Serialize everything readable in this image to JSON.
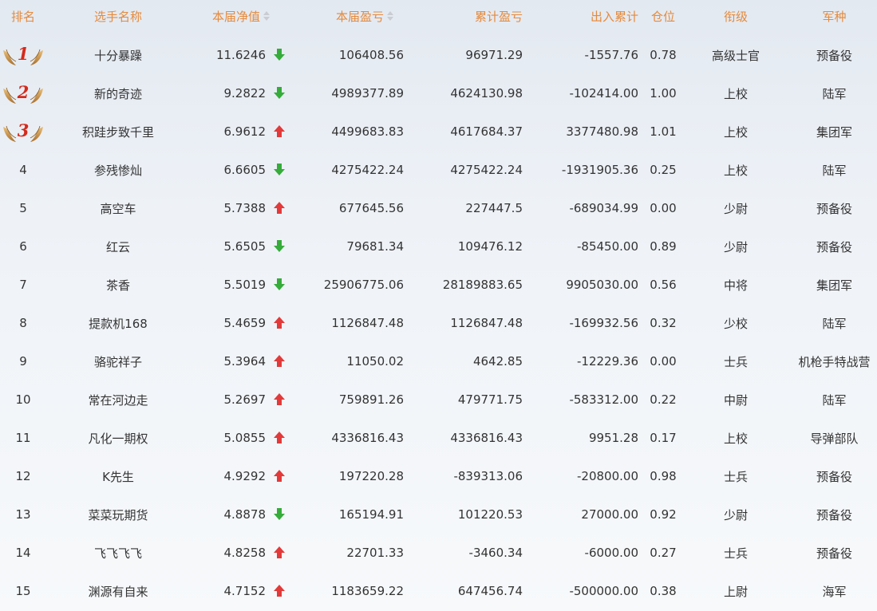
{
  "headers": {
    "rank": "排名",
    "name": "选手名称",
    "nav": "本届净值",
    "pnl": "本届盈亏",
    "total_pnl": "累计盈亏",
    "cash_flow": "出入累计",
    "position": "仓位",
    "military_rank": "衔级",
    "army": "军种"
  },
  "colors": {
    "header_text": "#e58a3c",
    "up_arrow": "#e23a3a",
    "down_arrow": "#36ac3b",
    "medal_number": "#d42a1c"
  },
  "rows": [
    {
      "rank": "1",
      "medal": true,
      "name": "十分暴躁",
      "nav": "11.6246",
      "trend": "down",
      "pnl": "106408.56",
      "total_pnl": "96971.29",
      "cash_flow": "-1557.76",
      "position": "0.78",
      "military_rank": "高级士官",
      "army": "预备役"
    },
    {
      "rank": "2",
      "medal": true,
      "name": "新的奇迹",
      "nav": "9.2822",
      "trend": "down",
      "pnl": "4989377.89",
      "total_pnl": "4624130.98",
      "cash_flow": "-102414.00",
      "position": "1.00",
      "military_rank": "上校",
      "army": "陆军"
    },
    {
      "rank": "3",
      "medal": true,
      "name": "积跬步致千里",
      "nav": "6.9612",
      "trend": "up",
      "pnl": "4499683.83",
      "total_pnl": "4617684.37",
      "cash_flow": "3377480.98",
      "position": "1.01",
      "military_rank": "上校",
      "army": "集团军"
    },
    {
      "rank": "4",
      "medal": false,
      "name": "参残惨灿",
      "nav": "6.6605",
      "trend": "down",
      "pnl": "4275422.24",
      "total_pnl": "4275422.24",
      "cash_flow": "-1931905.36",
      "position": "0.25",
      "military_rank": "上校",
      "army": "陆军"
    },
    {
      "rank": "5",
      "medal": false,
      "name": "高空车",
      "nav": "5.7388",
      "trend": "up",
      "pnl": "677645.56",
      "total_pnl": "227447.5",
      "cash_flow": "-689034.99",
      "position": "0.00",
      "military_rank": "少尉",
      "army": "预备役"
    },
    {
      "rank": "6",
      "medal": false,
      "name": "红云",
      "nav": "5.6505",
      "trend": "down",
      "pnl": "79681.34",
      "total_pnl": "109476.12",
      "cash_flow": "-85450.00",
      "position": "0.89",
      "military_rank": "少尉",
      "army": "预备役"
    },
    {
      "rank": "7",
      "medal": false,
      "name": "茶香",
      "nav": "5.5019",
      "trend": "down",
      "pnl": "25906775.06",
      "total_pnl": "28189883.65",
      "cash_flow": "9905030.00",
      "position": "0.56",
      "military_rank": "中将",
      "army": "集团军"
    },
    {
      "rank": "8",
      "medal": false,
      "name": "提款机168",
      "nav": "5.4659",
      "trend": "up",
      "pnl": "1126847.48",
      "total_pnl": "1126847.48",
      "cash_flow": "-169932.56",
      "position": "0.32",
      "military_rank": "少校",
      "army": "陆军"
    },
    {
      "rank": "9",
      "medal": false,
      "name": "骆驼祥子",
      "nav": "5.3964",
      "trend": "up",
      "pnl": "11050.02",
      "total_pnl": "4642.85",
      "cash_flow": "-12229.36",
      "position": "0.00",
      "military_rank": "士兵",
      "army": "机枪手特战营"
    },
    {
      "rank": "10",
      "medal": false,
      "name": "常在河边走",
      "nav": "5.2697",
      "trend": "up",
      "pnl": "759891.26",
      "total_pnl": "479771.75",
      "cash_flow": "-583312.00",
      "position": "0.22",
      "military_rank": "中尉",
      "army": "陆军"
    },
    {
      "rank": "11",
      "medal": false,
      "name": "凡化一期权",
      "nav": "5.0855",
      "trend": "up",
      "pnl": "4336816.43",
      "total_pnl": "4336816.43",
      "cash_flow": "9951.28",
      "position": "0.17",
      "military_rank": "上校",
      "army": "导弹部队"
    },
    {
      "rank": "12",
      "medal": false,
      "name": "K先生",
      "nav": "4.9292",
      "trend": "up",
      "pnl": "197220.28",
      "total_pnl": "-839313.06",
      "cash_flow": "-20800.00",
      "position": "0.98",
      "military_rank": "士兵",
      "army": "预备役"
    },
    {
      "rank": "13",
      "medal": false,
      "name": "菜菜玩期货",
      "nav": "4.8878",
      "trend": "down",
      "pnl": "165194.91",
      "total_pnl": "101220.53",
      "cash_flow": "27000.00",
      "position": "0.92",
      "military_rank": "少尉",
      "army": "预备役"
    },
    {
      "rank": "14",
      "medal": false,
      "name": "飞飞飞飞",
      "nav": "4.8258",
      "trend": "up",
      "pnl": "22701.33",
      "total_pnl": "-3460.34",
      "cash_flow": "-6000.00",
      "position": "0.27",
      "military_rank": "士兵",
      "army": "预备役"
    },
    {
      "rank": "15",
      "medal": false,
      "name": "渊源有自来",
      "nav": "4.7152",
      "trend": "up",
      "pnl": "1183659.22",
      "total_pnl": "647456.74",
      "cash_flow": "-500000.00",
      "position": "0.38",
      "military_rank": "上尉",
      "army": "海军"
    }
  ]
}
